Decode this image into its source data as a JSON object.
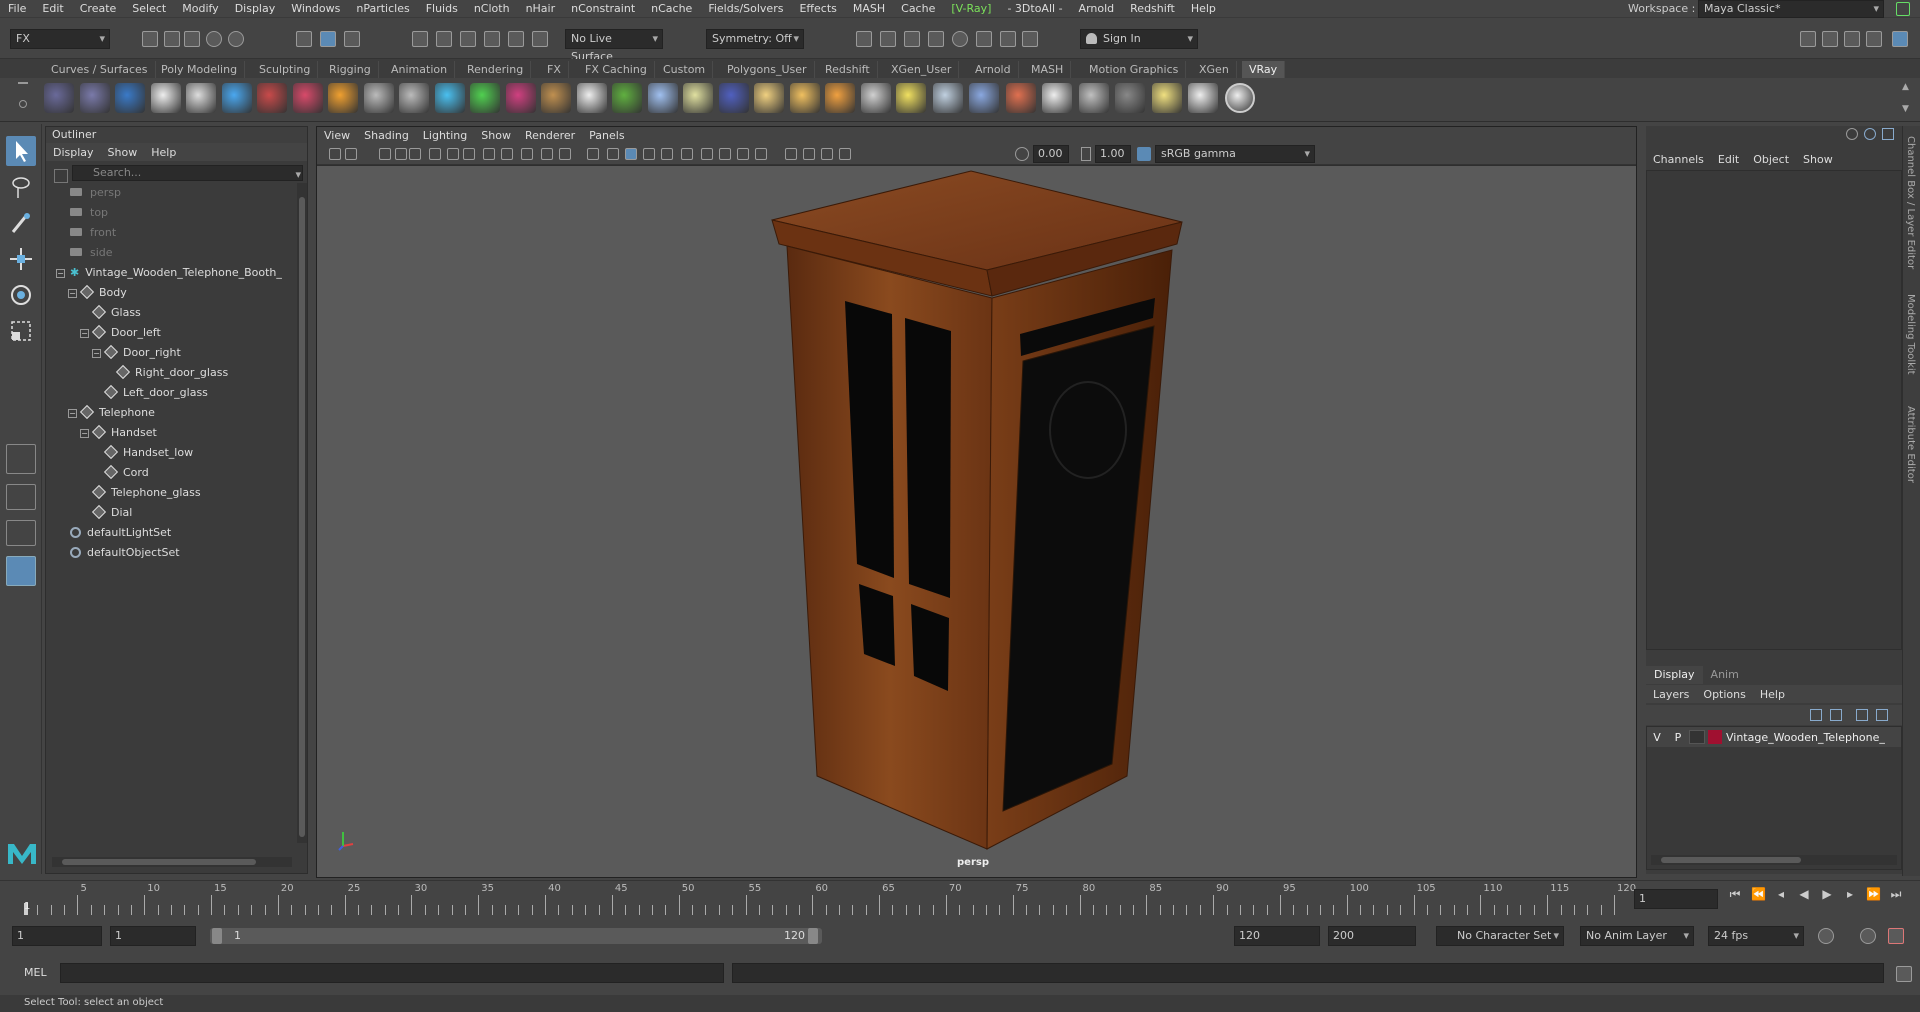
{
  "menubar": {
    "items": [
      "File",
      "Edit",
      "Create",
      "Select",
      "Modify",
      "Display",
      "Windows",
      "nParticles",
      "Fluids",
      "nCloth",
      "nHair",
      "nConstraint",
      "nCache",
      "Fields/Solvers",
      "Effects",
      "MASH",
      "Cache",
      "[V-Ray]",
      "- 3DtoAll -",
      "Arnold",
      "Redshift",
      "Help"
    ],
    "workspace_label": "Workspace :",
    "workspace_value": "Maya Classic*"
  },
  "statusline": {
    "menuset": "FX",
    "live_surface": "No Live Surface",
    "symmetry": "Symmetry: Off",
    "sign_in": "Sign In"
  },
  "shelf": {
    "tabs": [
      "Curves / Surfaces",
      "Poly Modeling",
      "Sculpting",
      "Rigging",
      "Animation",
      "Rendering",
      "FX",
      "FX Caching",
      "Custom",
      "Polygons_User",
      "Redshift",
      "XGen_User",
      "Arnold",
      "MASH",
      "Motion Graphics",
      "XGen",
      "VRay"
    ],
    "active_tab": "VRay"
  },
  "outliner": {
    "title": "Outliner",
    "menu": [
      "Display",
      "Show",
      "Help"
    ],
    "search_placeholder": "Search...",
    "items": [
      {
        "label": "persp",
        "depth": 0,
        "kind": "camera",
        "dim": true
      },
      {
        "label": "top",
        "depth": 0,
        "kind": "camera",
        "dim": true
      },
      {
        "label": "front",
        "depth": 0,
        "kind": "camera",
        "dim": true
      },
      {
        "label": "side",
        "depth": 0,
        "kind": "camera",
        "dim": true
      },
      {
        "label": "Vintage_Wooden_Telephone_Booth_",
        "depth": 0,
        "kind": "group",
        "dim": false
      },
      {
        "label": "Body",
        "depth": 1,
        "kind": "mesh",
        "dim": false
      },
      {
        "label": "Glass",
        "depth": 2,
        "kind": "mesh",
        "dim": false
      },
      {
        "label": "Door_left",
        "depth": 2,
        "kind": "mesh",
        "dim": false
      },
      {
        "label": "Door_right",
        "depth": 3,
        "kind": "mesh",
        "dim": false
      },
      {
        "label": "Right_door_glass",
        "depth": 4,
        "kind": "mesh",
        "dim": false
      },
      {
        "label": "Left_door_glass",
        "depth": 3,
        "kind": "mesh",
        "dim": false
      },
      {
        "label": "Telephone",
        "depth": 1,
        "kind": "mesh",
        "dim": false
      },
      {
        "label": "Handset",
        "depth": 2,
        "kind": "mesh",
        "dim": false
      },
      {
        "label": "Handset_low",
        "depth": 3,
        "kind": "mesh",
        "dim": false
      },
      {
        "label": "Cord",
        "depth": 3,
        "kind": "mesh",
        "dim": false
      },
      {
        "label": "Telephone_glass",
        "depth": 2,
        "kind": "mesh",
        "dim": false
      },
      {
        "label": "Dial",
        "depth": 2,
        "kind": "mesh",
        "dim": false
      },
      {
        "label": "defaultLightSet",
        "depth": 0,
        "kind": "set",
        "dim": false
      },
      {
        "label": "defaultObjectSet",
        "depth": 0,
        "kind": "set",
        "dim": false
      }
    ]
  },
  "viewport": {
    "menu": [
      "View",
      "Shading",
      "Lighting",
      "Show",
      "Renderer",
      "Panels"
    ],
    "exposure": "0.00",
    "gamma": "1.00",
    "color_space": "sRGB gamma",
    "camera_label": "persp"
  },
  "channelbox": {
    "menu": [
      "Channels",
      "Edit",
      "Object",
      "Show"
    ]
  },
  "layereditor": {
    "tabs": [
      "Display",
      "Anim"
    ],
    "menu": [
      "Layers",
      "Options",
      "Help"
    ],
    "layer": {
      "v": "V",
      "p": "P",
      "name": "Vintage_Wooden_Telephone_",
      "color": "#a01030"
    }
  },
  "sidetabs": [
    "Channel Box / Layer Editor",
    "Modeling Toolkit",
    "Attribute Editor"
  ],
  "timeslider": {
    "ticks": [
      5,
      10,
      15,
      20,
      25,
      30,
      35,
      40,
      45,
      50,
      55,
      60,
      65,
      70,
      75,
      80,
      85,
      90,
      95,
      100,
      105,
      110,
      115,
      120
    ],
    "start": 1,
    "end": 120,
    "current_marker": "1",
    "current_frame": "1"
  },
  "rangebar": {
    "start": "1",
    "playback_start": "1",
    "slider_start": "1",
    "slider_end": "120",
    "playback_end": "120",
    "end": "200",
    "character_set": "No Character Set",
    "anim_layer": "No Anim Layer",
    "fps": "24 fps"
  },
  "cmdline": {
    "label": "MEL"
  },
  "helpline": {
    "text": "Select Tool: select an object"
  }
}
